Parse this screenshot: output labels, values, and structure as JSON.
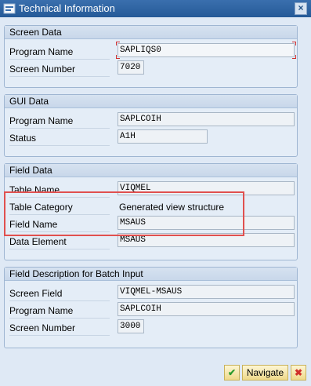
{
  "window": {
    "title": "Technical Information",
    "close_glyph": "×"
  },
  "groups": [
    {
      "title": "Screen Data",
      "rows": [
        {
          "label": "Program Name",
          "value": "SAPLIQS0"
        },
        {
          "label": "Screen Number",
          "value": "7020"
        }
      ]
    },
    {
      "title": "GUI Data",
      "rows": [
        {
          "label": "Program Name",
          "value": "SAPLCOIH"
        },
        {
          "label": "Status",
          "value": "A1H"
        }
      ]
    },
    {
      "title": "Field Data",
      "rows": [
        {
          "label": "Table Name",
          "value": "VIQMEL"
        },
        {
          "label": "Table Category",
          "value": "Generated view structure"
        },
        {
          "label": "Field Name",
          "value": "MSAUS"
        },
        {
          "label": "Data Element",
          "value": "MSAUS"
        }
      ]
    },
    {
      "title": "Field Description for Batch Input",
      "rows": [
        {
          "label": "Screen Field",
          "value": "VIQMEL-MSAUS"
        },
        {
          "label": "Program Name",
          "value": "SAPLCOIH"
        },
        {
          "label": "Screen Number",
          "value": "3000"
        }
      ]
    }
  ],
  "footer": {
    "navigate_label": "Navigate",
    "ok_glyph": "✔",
    "cancel_glyph": "✖"
  },
  "colors": {
    "titlebar": "#255a98",
    "highlight": "#e0504f",
    "ok": "#2e9b2e",
    "cancel": "#d0302a"
  }
}
